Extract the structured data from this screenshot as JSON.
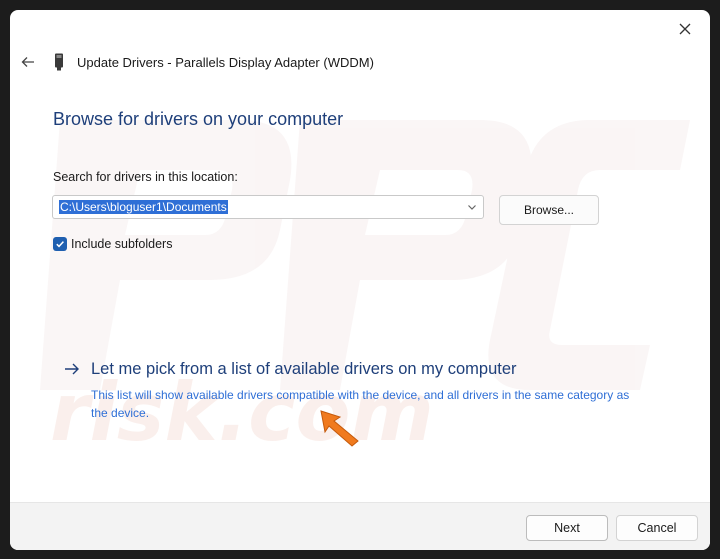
{
  "window": {
    "title": "Update Drivers - Parallels Display Adapter (WDDM)"
  },
  "main": {
    "heading": "Browse for drivers on your computer",
    "search_label": "Search for drivers in this location:",
    "path_value": "C:\\Users\\bloguser1\\Documents",
    "browse_label": "Browse...",
    "include_subfolders_label": "Include subfolders",
    "include_subfolders_checked": true,
    "pick_title": "Let me pick from a list of available drivers on my computer",
    "pick_description": "This list will show available drivers compatible with the device, and all drivers in the same category as the device."
  },
  "footer": {
    "next_label": "Next",
    "cancel_label": "Cancel"
  },
  "icons": {
    "close": "close-icon",
    "back": "back-arrow-icon",
    "device": "device-icon",
    "chevron": "chevron-down-icon",
    "check": "checkmark-icon",
    "link_arrow": "arrow-right-icon",
    "annotation": "orange-pointer-arrow"
  },
  "colors": {
    "heading": "#1e3f7a",
    "link_description": "#2f6fd6",
    "selection": "#2f6fd6",
    "checkbox": "#1f5fb0",
    "annotation_arrow": "#f07a1e"
  }
}
